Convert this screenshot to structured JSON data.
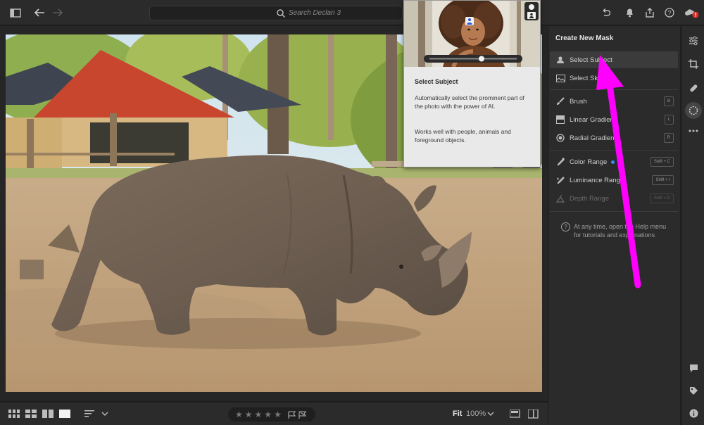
{
  "search": {
    "placeholder": "Search Declan 3"
  },
  "mask_panel": {
    "title": "Create New Mask",
    "items": [
      {
        "label": "Select Subject",
        "icon": "person-icon",
        "shortcut": ""
      },
      {
        "label": "Select Sky",
        "icon": "sky-icon",
        "shortcut": ""
      },
      {
        "label": "Brush",
        "icon": "brush-icon",
        "shortcut": "B"
      },
      {
        "label": "Linear Gradient",
        "icon": "linear-gradient-icon",
        "shortcut": "L"
      },
      {
        "label": "Radial Gradient",
        "icon": "radial-gradient-icon",
        "shortcut": "R"
      },
      {
        "label": "Color Range",
        "icon": "eyedropper-icon",
        "shortcut": "Shift + C"
      },
      {
        "label": "Luminance Range",
        "icon": "luminance-icon",
        "shortcut": "Shift + I"
      },
      {
        "label": "Depth Range",
        "icon": "depth-icon",
        "shortcut": "Shift + D"
      }
    ],
    "help_text": "At any time, open the Help menu for tutorials and explanations"
  },
  "popup": {
    "title": "Select Subject",
    "description": "Automatically select the prominent part of the photo with the power of AI.",
    "note": "Works well with people, animals and foreground objects."
  },
  "bottom_bar": {
    "stars": [
      "★",
      "★",
      "★",
      "★",
      "★"
    ],
    "fit": "Fit",
    "zoom": "100%"
  },
  "colors": {
    "accent": "#2f8dff",
    "annotation_arrow": "#ff00ff",
    "roof": "#c8452e"
  }
}
